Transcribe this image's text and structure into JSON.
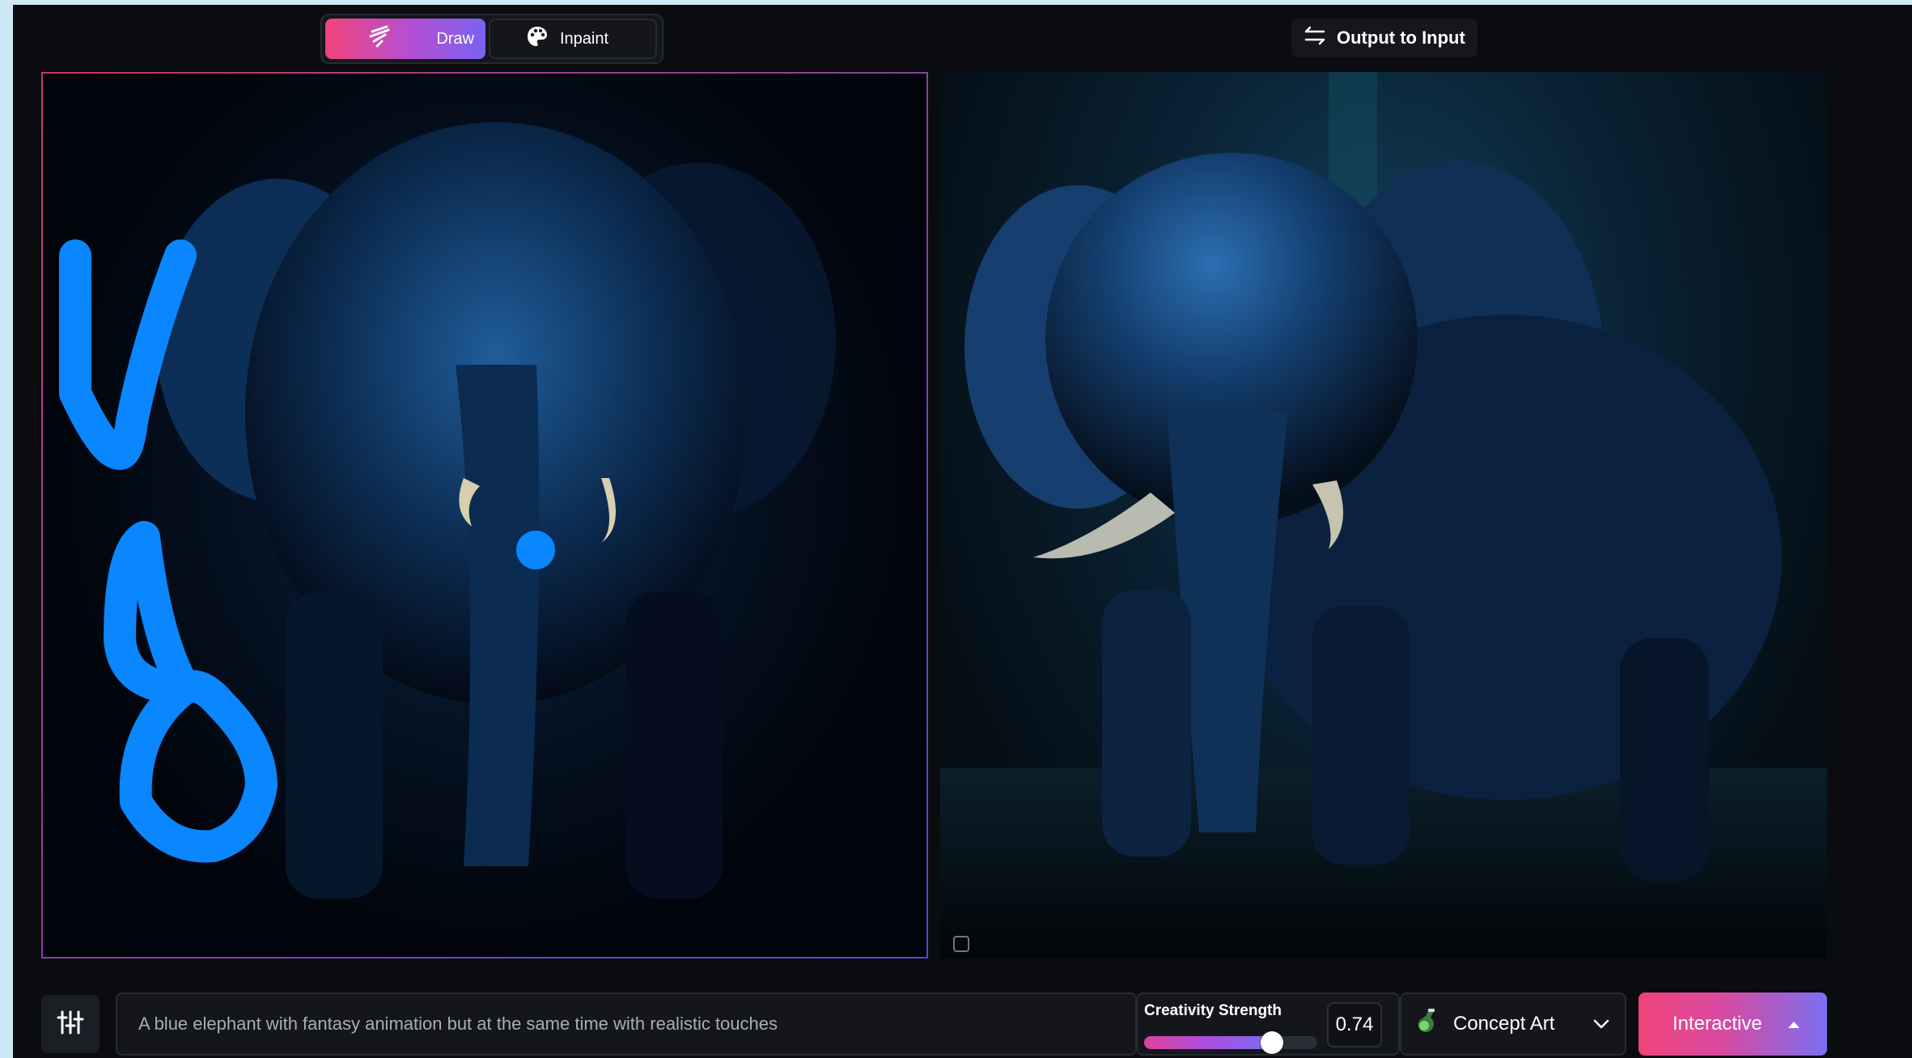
{
  "toolbar": {
    "draw_label": "Draw",
    "inpaint_label": "Inpaint",
    "output_to_input_label": "Output to Input"
  },
  "canvas_left": {
    "watermark": ""
  },
  "canvas_right": {
    "watermark": ""
  },
  "prompt": {
    "value": "A blue elephant with fantasy animation but at the same time with realistic touches"
  },
  "creativity": {
    "label": "Creativity Strength",
    "value": "0.74",
    "fraction": 0.74
  },
  "style": {
    "selected": "Concept Art"
  },
  "generate": {
    "label": "Interactive"
  },
  "colors": {
    "accent_pink": "#f0447a",
    "accent_purple": "#7a63f0",
    "stroke_blue": "#0a86ff"
  }
}
